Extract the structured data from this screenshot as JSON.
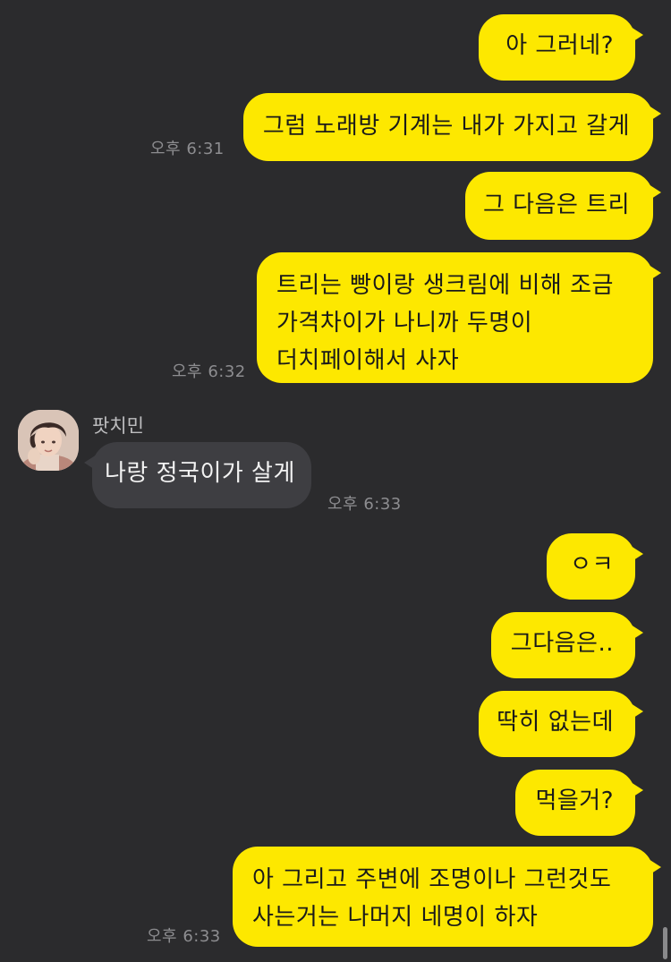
{
  "messages": [
    {
      "from": "me",
      "text": "아 그러네?"
    },
    {
      "from": "me",
      "text": "그럼 노래방 기계는 내가 가지고 갈게",
      "time": "오후 6:31"
    },
    {
      "from": "me",
      "text": "그 다음은 트리"
    },
    {
      "from": "me",
      "lines": [
        "트리는 빵이랑 생크림에 비해 조금",
        "가격차이가 나니까 두명이",
        "더치페이해서 사자"
      ],
      "time": "오후 6:32"
    },
    {
      "from": "them",
      "sender": "팟치민",
      "text": "나랑 정국이가 살게",
      "time": "오후 6:33"
    },
    {
      "from": "me",
      "text": "ㅇㅋ"
    },
    {
      "from": "me",
      "text": "그다음은.."
    },
    {
      "from": "me",
      "text": "딱히 없는데"
    },
    {
      "from": "me",
      "text": "먹을거?"
    },
    {
      "from": "me",
      "lines": [
        "아 그리고 주변에 조명이나 그런것도",
        "사는거는 나머지 네명이 하자"
      ],
      "time": "오후 6:33"
    }
  ],
  "colors": {
    "background": "#2b2b2d",
    "my_bubble": "#fde800",
    "their_bubble": "#3e3e42",
    "timestamp": "#8d8d90"
  },
  "icons": {
    "avatar": "profile-photo"
  }
}
